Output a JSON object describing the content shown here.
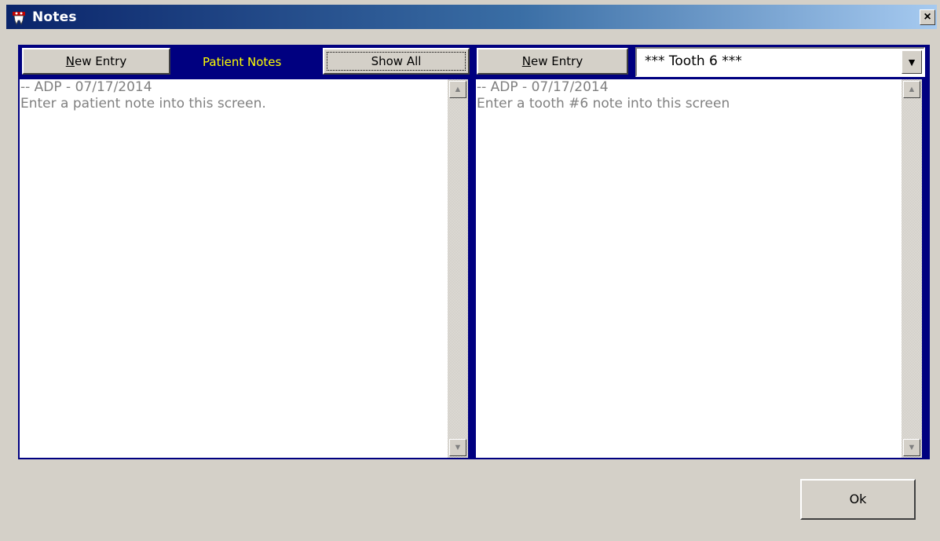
{
  "window": {
    "title": "Notes",
    "icon": "tooth-app-icon",
    "close_label": "×"
  },
  "left_pane": {
    "new_entry_label": "New Entry",
    "new_entry_hotkey": "N",
    "new_entry_rest": "ew Entry",
    "label": "Patient Notes",
    "show_all_label": "Show All",
    "notes": [
      "-- ADP - 07/17/2014",
      "Enter a patient note into this screen."
    ]
  },
  "right_pane": {
    "new_entry_label": "New Entry",
    "new_entry_hotkey": "N",
    "new_entry_rest": "ew Entry",
    "tooth_select_value": "*** Tooth  6 ***",
    "notes": [
      "-- ADP - 07/17/2014",
      "Enter a tooth #6 note into this screen"
    ]
  },
  "footer": {
    "ok_label": "Ok",
    "ok_hotkey": "O",
    "ok_rest": "k"
  },
  "colors": {
    "pane_border": "#000080",
    "pane_label": "#ffff00",
    "note_text": "#808080",
    "dialog_bg": "#d4d0c8"
  }
}
